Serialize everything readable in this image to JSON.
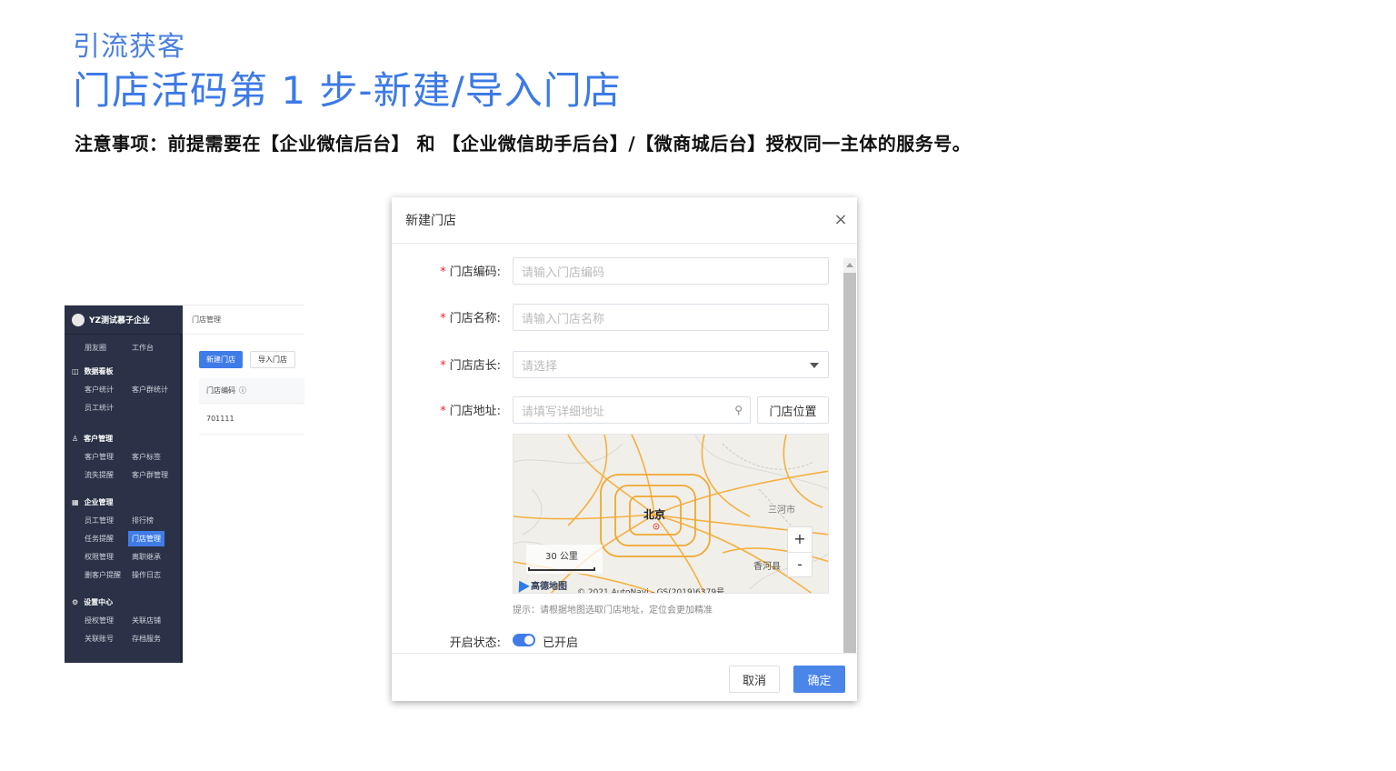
{
  "header": {
    "subtitle": "引流获客",
    "title": "门店活码第 1 步-新建/导入门店",
    "note": "注意事项：前提需要在【企业微信后台】 和 【企业微信助手后台】/【微商城后台】授权同一主体的服务号。"
  },
  "mini_admin": {
    "brand": "YZ测试慕子企业",
    "breadcrumb": "门店管理",
    "top_row": [
      "朋友圈",
      "工作台"
    ],
    "groups": [
      {
        "title": "数据看板",
        "icon": "chart-icon",
        "rows": [
          [
            "客户统计",
            "客户群统计"
          ],
          [
            "员工统计"
          ]
        ]
      },
      {
        "title": "客户管理",
        "icon": "user-icon",
        "rows": [
          [
            "客户管理",
            "客户标签"
          ],
          [
            "流失提醒",
            "客户群管理"
          ]
        ]
      },
      {
        "title": "企业管理",
        "icon": "building-icon",
        "rows": [
          [
            "员工管理",
            "排行榜"
          ],
          [
            "任务提醒",
            "门店管理"
          ],
          [
            "权限管理",
            "离职继承"
          ],
          [
            "删客户提醒",
            "操作日志"
          ]
        ]
      },
      {
        "title": "设置中心",
        "icon": "gear-icon",
        "rows": [
          [
            "授权管理",
            "关联店铺"
          ],
          [
            "关联账号",
            "存档服务"
          ]
        ]
      }
    ],
    "active_item": "门店管理",
    "new_store_button": "新建门店",
    "import_store_button": "导入门店",
    "table_header": "门店编码",
    "table_row_value": "701111"
  },
  "dialog": {
    "title": "新建门店",
    "fields": {
      "code": {
        "label": "门店编码:",
        "placeholder": "请输入门店编码"
      },
      "name": {
        "label": "门店名称:",
        "placeholder": "请输入门店名称"
      },
      "manager": {
        "label": "门店店长:",
        "placeholder": "请选择"
      },
      "address": {
        "label": "门店地址:",
        "placeholder": "请填写详细地址"
      }
    },
    "location_button": "门店位置",
    "map": {
      "city": "北京",
      "town_a": "三河市",
      "town_b": "香河县",
      "scale": "30 公里",
      "brand": "高德地图",
      "copyright": "© 2021 AutoNavi - GS(2019)6379号",
      "zoom_in": "+",
      "zoom_out": "-"
    },
    "hint": "提示：请根据地图选取门店地址，定位会更加精准",
    "status_label": "开启状态:",
    "status_value": "已开启",
    "cancel": "取消",
    "confirm": "确定"
  }
}
